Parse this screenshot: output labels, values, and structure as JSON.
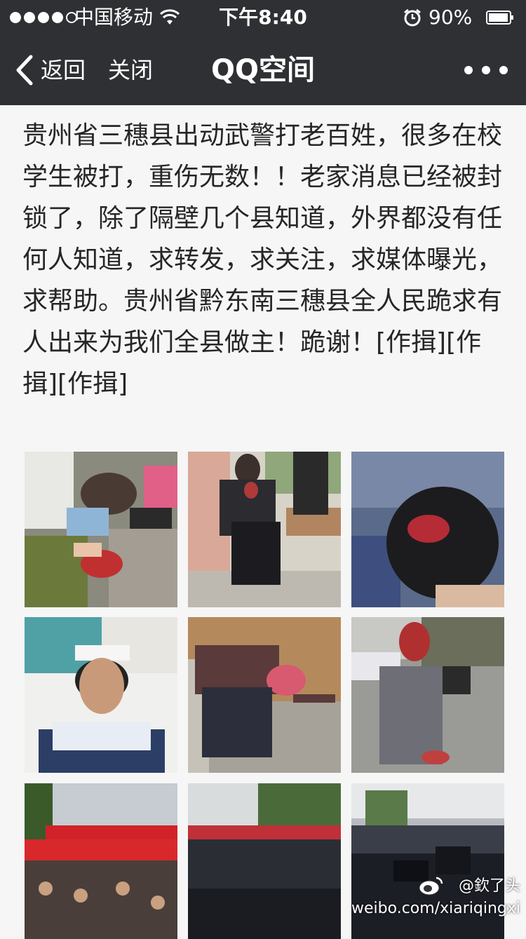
{
  "status_bar": {
    "carrier": "中国移动",
    "time": "下午8:40",
    "battery": "90%"
  },
  "nav": {
    "back_label": "返回",
    "close_label": "关闭",
    "title": "QQ空间"
  },
  "post": {
    "text": "贵州省三穗县出动武警打老百姓，很多在校学生被打，重伤无数！！老家消息已经被封锁了，除了隔壁几个县知道，外界都没有任何人知道，求转发，求关注，求媒体曝光，求帮助。贵州省黔东南三穗县全人民跪求有人出来为我们全县做主！跪谢！[作揖][作揖][作揖]"
  },
  "watermark": {
    "user": "@欽了头",
    "url": "weibo.com/xiariqingxi"
  },
  "icons": {
    "back": "chevron-left-icon",
    "more": "ellipsis-icon",
    "wifi": "wifi-icon",
    "alarm": "alarm-icon",
    "battery": "battery-icon",
    "weibo": "weibo-logo-icon"
  },
  "colors": {
    "nav_bg": "#2f3033",
    "text": "#262626",
    "content_bg": "#f6f6f6"
  }
}
